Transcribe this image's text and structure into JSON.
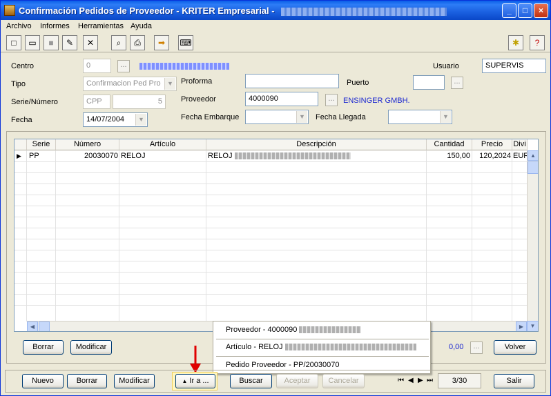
{
  "window": {
    "title": "Confirmación Pedidos de Proveedor - KRITER Empresarial - "
  },
  "menu": [
    "Archivo",
    "Informes",
    "Herramientas",
    "Ayuda"
  ],
  "form": {
    "centro_label": "Centro",
    "centro_value": "0",
    "tipo_label": "Tipo",
    "tipo_value": "Confirmacion Ped Pro",
    "serie_label": "Serie/Número",
    "serie_value": "CPP",
    "numero_value": "5",
    "fecha_label": "Fecha",
    "fecha_value": "14/07/2004",
    "proforma_label": "Proforma",
    "proforma_value": "",
    "proveedor_label": "Proveedor",
    "proveedor_value": "4000090",
    "proveedor_name": "ENSINGER GMBH.",
    "puerto_label": "Puerto",
    "puerto_value": "",
    "usuario_label": "Usuario",
    "usuario_value": "SUPERVIS",
    "fecha_embarque_label": "Fecha Embarque",
    "fecha_llegada_label": "Fecha Llegada"
  },
  "grid": {
    "columns": [
      "Serie",
      "Número",
      "Artículo",
      "Descripción",
      "Cantidad",
      "Precio",
      "Divi"
    ],
    "rows": [
      {
        "serie": "PP",
        "numero": "20030070",
        "articulo": "RELOJ",
        "descripcion": "RELOJ",
        "cantidad": "150,00",
        "precio": "120,2024",
        "divisa": "EUR"
      }
    ]
  },
  "panel": {
    "borrar": "Borrar",
    "modificar": "Modificar",
    "total": "0,00",
    "volver": "Volver"
  },
  "popup": {
    "item1": "Proveedor - 4000090",
    "item2": "Artículo - RELOJ",
    "item3": "Pedido Proveedor - PP/20030070"
  },
  "bottom": {
    "nuevo": "Nuevo",
    "borrar": "Borrar",
    "modificar": "Modificar",
    "ira": "Ir a ...",
    "buscar": "Buscar",
    "aceptar": "Aceptar",
    "cancelar": "Cancelar",
    "record": "3/30",
    "salir": "Salir"
  }
}
